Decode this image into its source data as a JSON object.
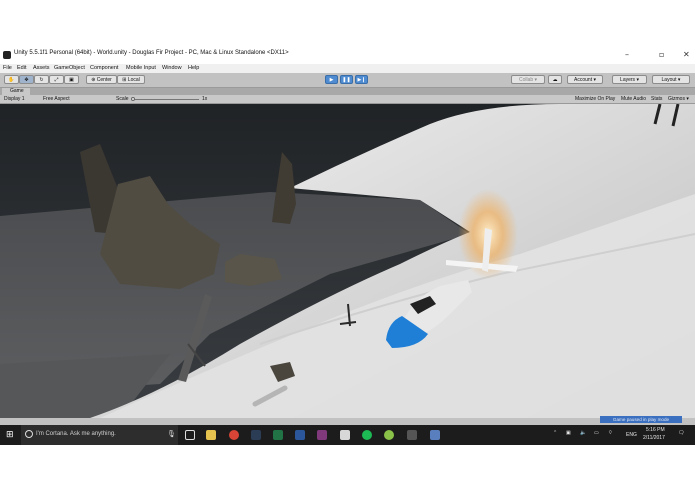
{
  "window": {
    "title": "Unity 5.5.1f1 Personal (64bit) - World.unity - Douglas Fir Project - PC, Mac & Linux Standalone <DX11>",
    "minimize": "–",
    "maximize": "▫",
    "close": "✕"
  },
  "menu": {
    "items": [
      "File",
      "Edit",
      "Assets",
      "GameObject",
      "Component",
      "Mobile Input",
      "Window",
      "Help"
    ]
  },
  "toolbar": {
    "center_label": "Center",
    "local_label": "Local",
    "collab_label": "Collab ▾",
    "account_label": "Account ▾",
    "layers_label": "Layers ▾",
    "layout_label": "Layout ▾",
    "play_icon": "▶",
    "pause_icon": "❚❚",
    "step_icon": "▶❙"
  },
  "game_view": {
    "tab_label": "Game",
    "display": "Display 1",
    "aspect": "Free Aspect",
    "scale_label": "Scale",
    "scale_value": "1x",
    "maximize_on_play": "Maximize On Play",
    "mute_audio": "Mute Audio",
    "stats": "Stats",
    "gizmos": "Gizmos ▾",
    "paused_message": "Game paused in play mode"
  },
  "taskbar": {
    "search_placeholder": "Ask me anything",
    "search_text": "I'm Cortana. Ask me anything.",
    "language": "ENG",
    "time": "5:16 PM",
    "date": "2/11/2017"
  },
  "colors": {
    "editor_bg": "#c2c2c2",
    "play_blue": "#4f8bd0",
    "taskbar": "#1c1c1c",
    "plane_blue": "#1f7fd6"
  }
}
